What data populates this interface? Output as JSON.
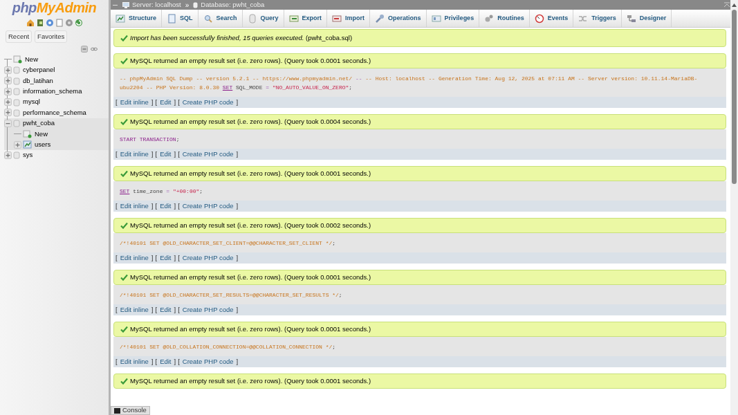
{
  "logo": {
    "part1": "php",
    "part2": "MyAdmin"
  },
  "panel_tabs": [
    {
      "label": "Recent"
    },
    {
      "label": "Favorites"
    }
  ],
  "tree": [
    {
      "label": "New",
      "kind": "new",
      "selected": false
    },
    {
      "label": "cyberpanel",
      "kind": "database",
      "expanded": false,
      "selected": false
    },
    {
      "label": "db_latihan",
      "kind": "database",
      "expanded": false,
      "selected": false
    },
    {
      "label": "information_schema",
      "kind": "database",
      "expanded": false,
      "selected": false
    },
    {
      "label": "mysql",
      "kind": "database",
      "expanded": false,
      "selected": false
    },
    {
      "label": "performance_schema",
      "kind": "database",
      "expanded": false,
      "selected": false
    },
    {
      "label": "pwht_coba",
      "kind": "database",
      "expanded": true,
      "selected": true,
      "children": [
        {
          "label": "New",
          "kind": "new",
          "selected": false
        },
        {
          "label": "users",
          "kind": "table",
          "expanded": false,
          "selected": false
        }
      ]
    },
    {
      "label": "sys",
      "kind": "database",
      "expanded": false,
      "selected": false
    }
  ],
  "breadcrumb": {
    "separator": "»",
    "items": [
      {
        "label": "Server: localhost",
        "kind": "server"
      },
      {
        "label": "Database: pwht_coba",
        "kind": "database"
      }
    ]
  },
  "tabs": [
    {
      "label": "Structure",
      "kind": "structure",
      "selected": false
    },
    {
      "label": "SQL",
      "kind": "sql",
      "selected": false
    },
    {
      "label": "Search",
      "kind": "search",
      "selected": false
    },
    {
      "label": "Query",
      "kind": "query",
      "selected": false
    },
    {
      "label": "Export",
      "kind": "export",
      "selected": false
    },
    {
      "label": "Import",
      "kind": "import",
      "selected": false
    },
    {
      "label": "Operations",
      "kind": "operations",
      "selected": false
    },
    {
      "label": "Privileges",
      "kind": "privileges",
      "selected": false
    },
    {
      "label": "Routines",
      "kind": "routines",
      "selected": false
    },
    {
      "label": "Events",
      "kind": "events",
      "selected": false
    },
    {
      "label": "Triggers",
      "kind": "triggers",
      "selected": false
    },
    {
      "label": "Designer",
      "kind": "designer",
      "selected": false
    }
  ],
  "import_message": "*Import has been successfully finished, 15 queries executed.* (pwht_coba.sql)",
  "action_brackets": [
    "[",
    "]"
  ],
  "results": [
    {
      "message": "MySQL returned an empty result set (i.e. zero rows). (Query took 0.0001 seconds.)",
      "sql": [
        {
          "kind": "comment",
          "text": "-- phpMyAdmin SQL Dump -- version 5.2.1 -- https://www.phpmyadmin.net/"
        },
        {
          "kind": "operator",
          "text": "--"
        },
        {
          "kind": "comment",
          "text": "-- Host: localhost -- Generation Time: Aug 12, 2025 at 07:11 AM -- Server version: 10.11.14-MariaDB-ubu2204 -- PHP Version: 8.0.30"
        },
        {
          "kind": "keyword_link",
          "text": "SET"
        },
        {
          "kind": "plain",
          "text": "SQL_MODE"
        },
        {
          "kind": "operator",
          "text": "="
        },
        {
          "kind": "string",
          "text": "\"NO_AUTO_VALUE_ON_ZERO\""
        },
        {
          "kind": "punct",
          "text": ";"
        }
      ],
      "actions": [
        {
          "label": "Edit inline"
        },
        {
          "label": "Edit"
        },
        {
          "label": "Create PHP code"
        }
      ]
    },
    {
      "message": "MySQL returned an empty result set (i.e. zero rows). (Query took 0.0004 seconds.)",
      "sql": [
        {
          "kind": "keyword",
          "text": "START TRANSACTION"
        },
        {
          "kind": "punct",
          "text": ";"
        }
      ],
      "actions": [
        {
          "label": "Edit inline"
        },
        {
          "label": "Edit"
        },
        {
          "label": "Create PHP code"
        }
      ]
    },
    {
      "message": "MySQL returned an empty result set (i.e. zero rows). (Query took 0.0001 seconds.)",
      "sql": [
        {
          "kind": "keyword_link",
          "text": "SET"
        },
        {
          "kind": "plain",
          "text": "time_zone"
        },
        {
          "kind": "operator",
          "text": "="
        },
        {
          "kind": "string",
          "text": "\"+00:00\""
        },
        {
          "kind": "punct",
          "text": ";"
        }
      ],
      "actions": [
        {
          "label": "Edit inline"
        },
        {
          "label": "Edit"
        },
        {
          "label": "Create PHP code"
        }
      ]
    },
    {
      "message": "MySQL returned an empty result set (i.e. zero rows). (Query took 0.0002 seconds.)",
      "sql": [
        {
          "kind": "comment",
          "text": "/*!40101 SET @OLD_CHARACTER_SET_CLIENT=@@CHARACTER_SET_CLIENT */"
        },
        {
          "kind": "punct",
          "text": ";"
        }
      ],
      "actions": [
        {
          "label": "Edit inline"
        },
        {
          "label": "Edit"
        },
        {
          "label": "Create PHP code"
        }
      ]
    },
    {
      "message": "MySQL returned an empty result set (i.e. zero rows). (Query took 0.0001 seconds.)",
      "sql": [
        {
          "kind": "comment",
          "text": "/*!40101 SET @OLD_CHARACTER_SET_RESULTS=@@CHARACTER_SET_RESULTS */"
        },
        {
          "kind": "punct",
          "text": ";"
        }
      ],
      "actions": [
        {
          "label": "Edit inline"
        },
        {
          "label": "Edit"
        },
        {
          "label": "Create PHP code"
        }
      ]
    },
    {
      "message": "MySQL returned an empty result set (i.e. zero rows). (Query took 0.0001 seconds.)",
      "sql": [
        {
          "kind": "comment",
          "text": "/*!40101 SET @OLD_COLLATION_CONNECTION=@@COLLATION_CONNECTION */"
        },
        {
          "kind": "punct",
          "text": ";"
        }
      ],
      "actions": [
        {
          "label": "Edit inline"
        },
        {
          "label": "Edit"
        },
        {
          "label": "Create PHP code"
        }
      ]
    },
    {
      "message": "MySQL returned an empty result set (i.e. zero rows). (Query took 0.0001 seconds.)"
    }
  ],
  "console": {
    "label": "Console"
  }
}
